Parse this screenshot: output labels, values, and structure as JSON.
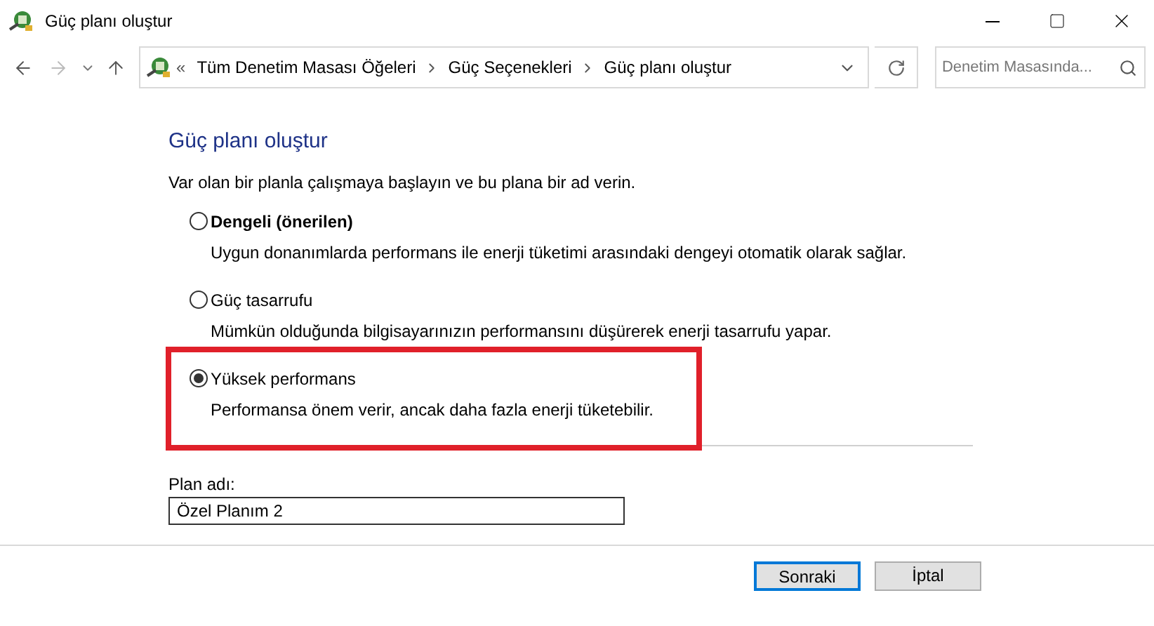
{
  "window": {
    "title": "Güç planı oluştur"
  },
  "address_bar": {
    "overflow": "«",
    "crumbs": [
      "Tüm Denetim Masası Öğeleri",
      "Güç Seçenekleri",
      "Güç planı oluştur"
    ]
  },
  "search": {
    "placeholder": "Denetim Masasında..."
  },
  "heading": "Güç planı oluştur",
  "intro": "Var olan bir planla çalışmaya başlayın ve bu plana bir ad verin.",
  "plans": [
    {
      "name": "Dengeli (önerilen)",
      "description": "Uygun donanımlarda performans ile enerji tüketimi arasındaki dengeyi otomatik olarak sağlar.",
      "selected": false,
      "bold": true,
      "highlighted": false
    },
    {
      "name": "Güç tasarrufu",
      "description": "Mümkün olduğunda bilgisayarınızın performansını düşürerek enerji tasarrufu yapar.",
      "selected": false,
      "bold": false,
      "highlighted": false
    },
    {
      "name": "Yüksek performans",
      "description": "Performansa önem verir, ancak daha fazla enerji tüketebilir.",
      "selected": true,
      "bold": false,
      "highlighted": true
    }
  ],
  "plan_name": {
    "label": "Plan adı:",
    "value": "Özel Planım 2"
  },
  "buttons": [
    {
      "label": "Sonraki",
      "default": true
    },
    {
      "label": "İptal",
      "default": false
    }
  ]
}
